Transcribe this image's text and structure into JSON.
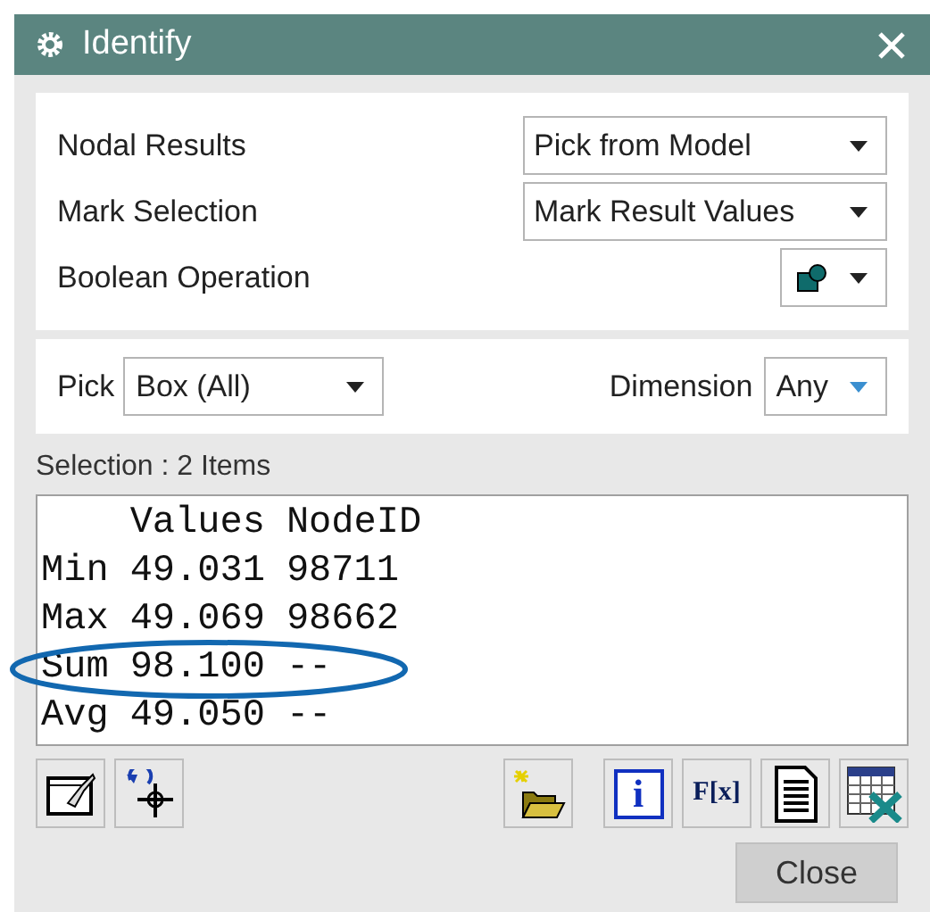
{
  "window": {
    "title": "Identify"
  },
  "options": [
    {
      "label": "Nodal Results",
      "kind": "text",
      "value": "Pick from Model"
    },
    {
      "label": "Mark Selection",
      "kind": "text",
      "value": "Mark Result Values"
    },
    {
      "label": "Boolean Operation",
      "kind": "icon"
    }
  ],
  "pick": {
    "label": "Pick",
    "value": "Box (All)"
  },
  "dimension": {
    "label": "Dimension",
    "value": "Any"
  },
  "selection": {
    "label": "Selection : 2 Items"
  },
  "results": {
    "columns": [
      "Values",
      "NodeID"
    ],
    "rows": [
      {
        "name": "Min",
        "value": "49.031",
        "node": "98711"
      },
      {
        "name": "Max",
        "value": "49.069",
        "node": "98662"
      },
      {
        "name": "Sum",
        "value": "98.100",
        "node": "--"
      },
      {
        "name": "Avg",
        "value": "49.050",
        "node": "--"
      }
    ]
  },
  "tools_left": [
    {
      "kind": "mark"
    },
    {
      "kind": "reset"
    }
  ],
  "tools_right": [
    {
      "kind": "open"
    },
    {
      "kind": "info",
      "label": "i"
    },
    {
      "kind": "formula",
      "label": "F[x]"
    },
    {
      "kind": "document"
    },
    {
      "kind": "spreadsheet"
    }
  ],
  "buttons": [
    "Close"
  ]
}
